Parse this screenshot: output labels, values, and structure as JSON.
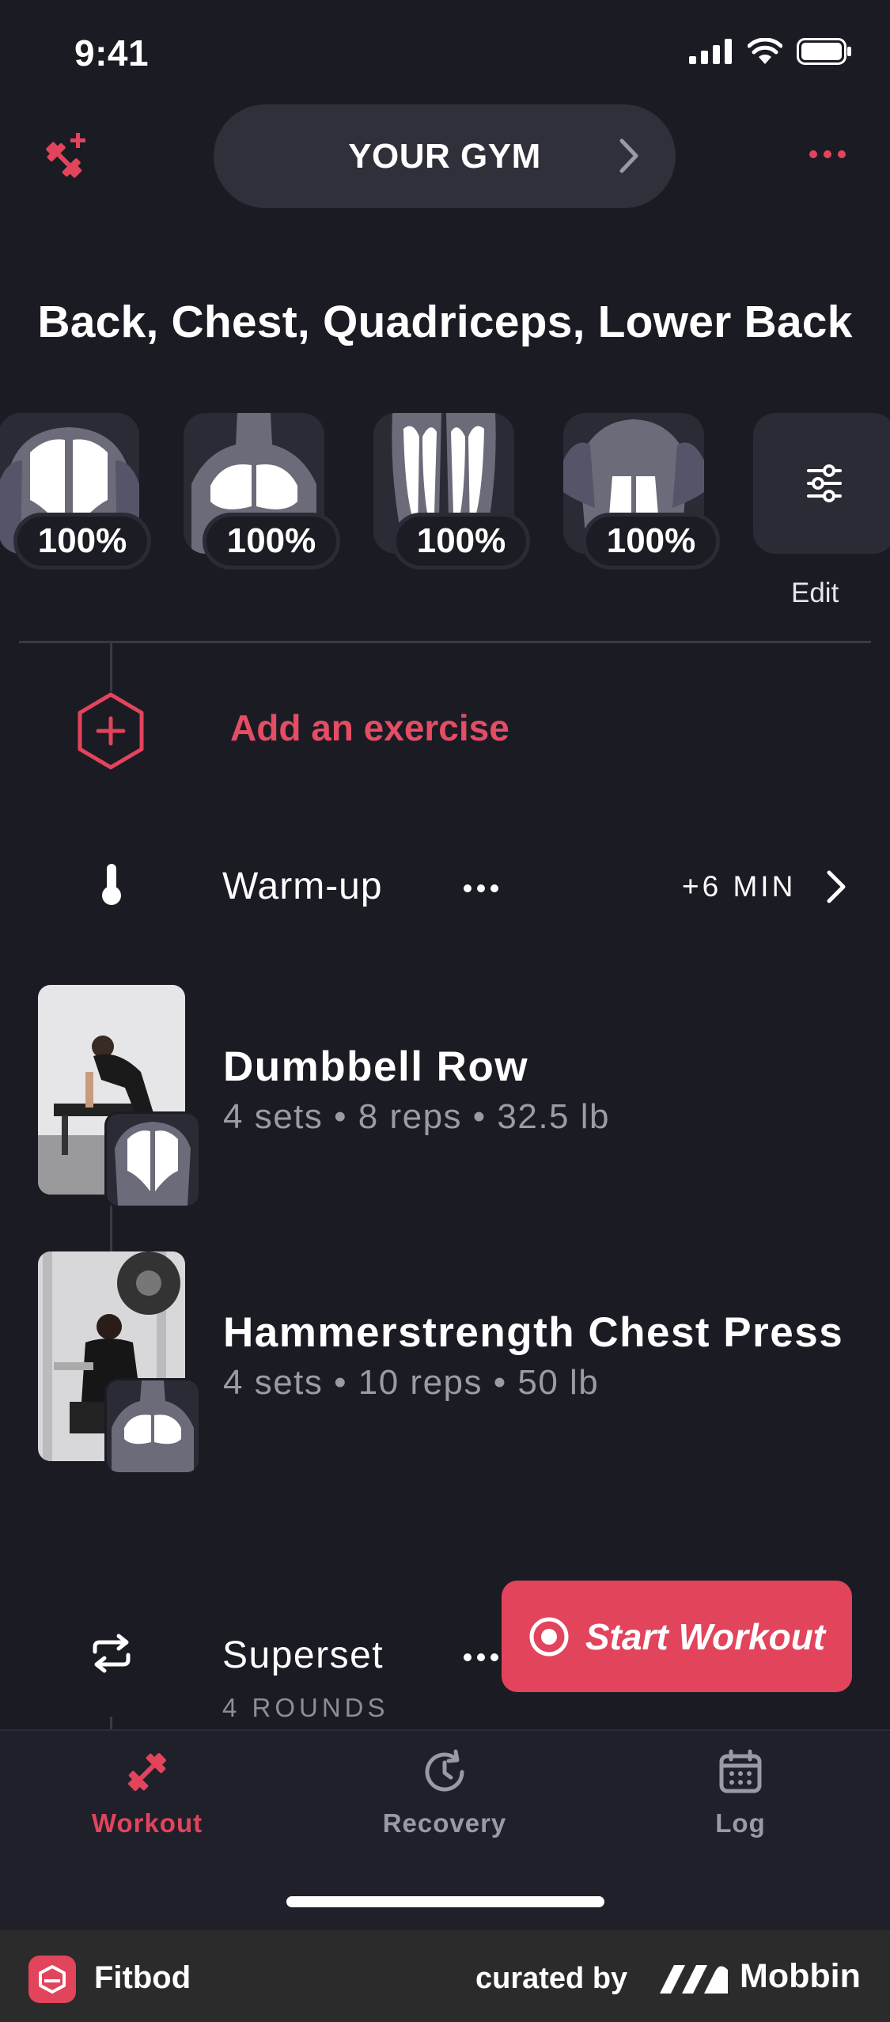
{
  "status_bar": {
    "time": "9:41"
  },
  "header": {
    "gym_label": "YOUR GYM"
  },
  "muscles": {
    "title": "Back, Chest, Quadriceps, Lower Back",
    "items": [
      {
        "name": "back",
        "percent": "100%"
      },
      {
        "name": "chest",
        "percent": "100%"
      },
      {
        "name": "quadriceps",
        "percent": "100%"
      },
      {
        "name": "lower-back",
        "percent": "100%"
      }
    ],
    "edit_label": "Edit"
  },
  "add_exercise": {
    "label": "Add an exercise"
  },
  "warmup": {
    "label": "Warm-up",
    "duration": "+6 MIN"
  },
  "exercises": [
    {
      "name": "Dumbbell Row",
      "meta": "4 sets • 8 reps • 32.5 lb"
    },
    {
      "name": "Hammerstrength Chest Press",
      "meta": "4 sets • 10 reps • 50 lb"
    }
  ],
  "superset": {
    "label": "Superset",
    "rounds": "4 ROUNDS"
  },
  "start_button": {
    "label": "Start Workout"
  },
  "tabs": [
    {
      "label": "Workout",
      "icon": "dumbbell-icon",
      "active": true
    },
    {
      "label": "Recovery",
      "icon": "recovery-clock-icon",
      "active": false
    },
    {
      "label": "Log",
      "icon": "calendar-icon",
      "active": false
    }
  ],
  "footer": {
    "app_name": "Fitbod",
    "curated_by": "curated by",
    "brand": "Mobbin"
  },
  "colors": {
    "background": "#1b1b24",
    "accent": "#e2445c",
    "card": "#2b2b36"
  }
}
